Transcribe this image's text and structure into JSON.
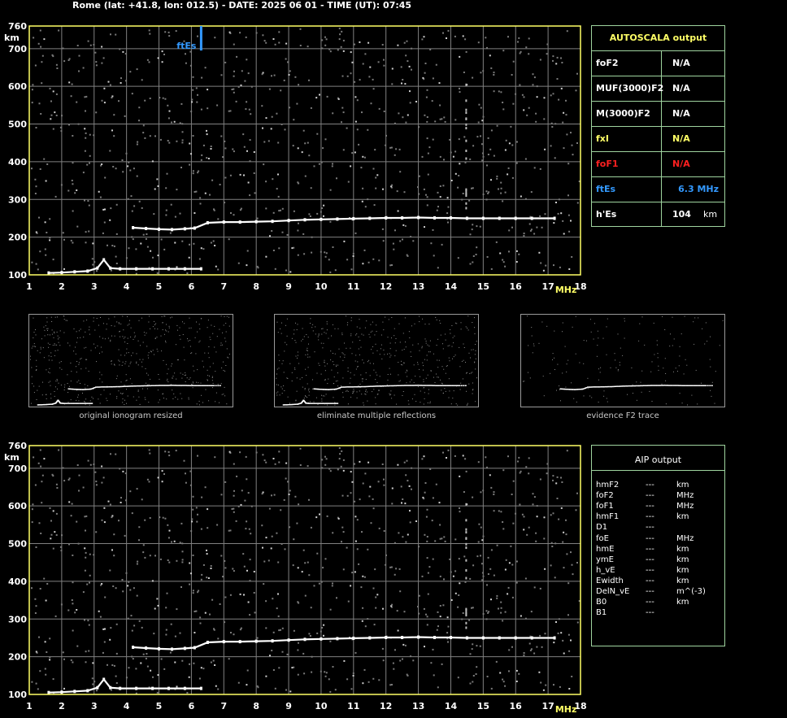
{
  "header": {
    "title": "Rome (lat: +41.8, lon: 012.5) - DATE: 2025 06 01 - TIME (UT): 07:45"
  },
  "colors": {
    "axis": "#ffff66",
    "grid": "#808080",
    "trace": "#ffffff",
    "panel_border": "#9fd49f",
    "label_yellow": "#ffff66",
    "label_white": "#ffffff",
    "label_red": "#ff2020",
    "label_blue": "#3399ff"
  },
  "autoscala": {
    "title": "AUTOSCALA output",
    "rows": [
      {
        "param": "foF2",
        "value": "N/A",
        "unit": "",
        "color": "#ffffff"
      },
      {
        "param": "MUF(3000)F2",
        "value": "N/A",
        "unit": "",
        "color": "#ffffff"
      },
      {
        "param": "M(3000)F2",
        "value": "N/A",
        "unit": "",
        "color": "#ffffff"
      },
      {
        "param": "fxI",
        "value": "N/A",
        "unit": "",
        "color": "#ffff66"
      },
      {
        "param": "foF1",
        "value": "N/A",
        "unit": "",
        "color": "#ff2020"
      },
      {
        "param": "ftEs",
        "value": "6.3 MHz",
        "unit": "",
        "color": "#3399ff"
      },
      {
        "param": "h'Es",
        "value": "104",
        "unit": "km",
        "color": "#ffffff"
      }
    ]
  },
  "thumbnails": [
    {
      "caption": "original ionogram resized"
    },
    {
      "caption": "eliminate multiple reflections"
    },
    {
      "caption": "evidence F2 trace"
    }
  ],
  "aip": {
    "title": "AIP output",
    "rows": [
      {
        "param": "hmF2",
        "value": "---",
        "unit": "km"
      },
      {
        "param": "foF2",
        "value": "---",
        "unit": "MHz"
      },
      {
        "param": "foF1",
        "value": "---",
        "unit": "MHz"
      },
      {
        "param": "hmF1",
        "value": "---",
        "unit": "km"
      },
      {
        "param": "D1",
        "value": "---",
        "unit": ""
      },
      {
        "param": "foE",
        "value": "---",
        "unit": "MHz"
      },
      {
        "param": "hmE",
        "value": "---",
        "unit": "km"
      },
      {
        "param": "ymE",
        "value": "---",
        "unit": "km"
      },
      {
        "param": "h_vE",
        "value": "---",
        "unit": "km"
      },
      {
        "param": "Ewidth",
        "value": "---",
        "unit": "km"
      },
      {
        "param": "DelN_vE",
        "value": "---",
        "unit": "m^(-3)"
      },
      {
        "param": "B0",
        "value": "---",
        "unit": "km"
      },
      {
        "param": "B1",
        "value": "---",
        "unit": ""
      }
    ]
  },
  "chart_data": [
    {
      "type": "scatter",
      "xlim": [
        1,
        18
      ],
      "ylim": [
        100,
        760
      ],
      "x_ticks": [
        "1",
        "2",
        "3",
        "4",
        "5",
        "6",
        "7",
        "8",
        "9",
        "10",
        "11",
        "12",
        "13",
        "14",
        "15",
        "16",
        "17",
        "18"
      ],
      "y_ticks": [
        "100",
        "200",
        "300",
        "400",
        "500",
        "600",
        "700",
        "760"
      ],
      "xunit": "MHz",
      "yunit": "km",
      "grid": true,
      "marker": {
        "label": "ftEs",
        "x": 6.3,
        "y_range": [
          695,
          760
        ],
        "color": "#3399ff"
      },
      "series": [
        {
          "points": [
            [
              1.6,
              105
            ],
            [
              2.0,
              106
            ],
            [
              2.4,
              108
            ],
            [
              2.8,
              110
            ],
            [
              3.1,
              118
            ],
            [
              3.3,
              140
            ],
            [
              3.5,
              118
            ],
            [
              3.8,
              116
            ],
            [
              4.3,
              116
            ],
            [
              4.8,
              116
            ],
            [
              5.3,
              116
            ],
            [
              5.8,
              116
            ],
            [
              6.3,
              116
            ]
          ]
        },
        {
          "points": [
            [
              4.2,
              225
            ],
            [
              4.6,
              223
            ],
            [
              5.0,
              221
            ],
            [
              5.4,
              220
            ],
            [
              5.8,
              222
            ],
            [
              6.1,
              224
            ],
            [
              6.5,
              238
            ],
            [
              7.0,
              240
            ],
            [
              7.5,
              240
            ],
            [
              8.0,
              241
            ],
            [
              8.5,
              242
            ],
            [
              9.0,
              244
            ],
            [
              9.5,
              246
            ],
            [
              10.0,
              247
            ],
            [
              10.5,
              248
            ],
            [
              11.0,
              249
            ],
            [
              11.5,
              250
            ],
            [
              12.0,
              251
            ],
            [
              12.5,
              251
            ],
            [
              13.0,
              252
            ],
            [
              13.5,
              251
            ],
            [
              14.0,
              251
            ],
            [
              14.5,
              250
            ],
            [
              15.0,
              250
            ],
            [
              15.5,
              250
            ],
            [
              16.0,
              250
            ],
            [
              16.5,
              250
            ],
            [
              17.2,
              250
            ]
          ]
        }
      ]
    },
    {
      "type": "scatter",
      "xlim": [
        1,
        18
      ],
      "ylim": [
        100,
        760
      ],
      "x_ticks": [
        "1",
        "2",
        "3",
        "4",
        "5",
        "6",
        "7",
        "8",
        "9",
        "10",
        "11",
        "12",
        "13",
        "14",
        "15",
        "16",
        "17",
        "18"
      ],
      "y_ticks": [
        "100",
        "200",
        "300",
        "400",
        "500",
        "600",
        "700",
        "760"
      ],
      "xunit": "MHz",
      "yunit": "km",
      "grid": true,
      "series": [
        {
          "points": [
            [
              1.6,
              105
            ],
            [
              2.0,
              106
            ],
            [
              2.4,
              108
            ],
            [
              2.8,
              110
            ],
            [
              3.1,
              118
            ],
            [
              3.3,
              140
            ],
            [
              3.5,
              118
            ],
            [
              3.8,
              116
            ],
            [
              4.3,
              116
            ],
            [
              4.8,
              116
            ],
            [
              5.3,
              116
            ],
            [
              5.8,
              116
            ],
            [
              6.3,
              116
            ]
          ]
        },
        {
          "points": [
            [
              4.2,
              225
            ],
            [
              4.6,
              223
            ],
            [
              5.0,
              221
            ],
            [
              5.4,
              220
            ],
            [
              5.8,
              222
            ],
            [
              6.1,
              224
            ],
            [
              6.5,
              238
            ],
            [
              7.0,
              240
            ],
            [
              7.5,
              240
            ],
            [
              8.0,
              241
            ],
            [
              8.5,
              242
            ],
            [
              9.0,
              244
            ],
            [
              9.5,
              246
            ],
            [
              10.0,
              247
            ],
            [
              10.5,
              248
            ],
            [
              11.0,
              249
            ],
            [
              11.5,
              250
            ],
            [
              12.0,
              251
            ],
            [
              12.5,
              251
            ],
            [
              13.0,
              252
            ],
            [
              13.5,
              251
            ],
            [
              14.0,
              251
            ],
            [
              14.5,
              250
            ],
            [
              15.0,
              250
            ],
            [
              15.5,
              250
            ],
            [
              16.0,
              250
            ],
            [
              16.5,
              250
            ],
            [
              17.2,
              250
            ]
          ]
        }
      ]
    }
  ]
}
